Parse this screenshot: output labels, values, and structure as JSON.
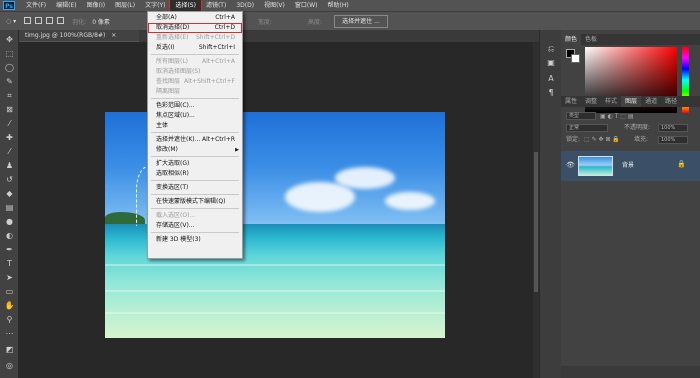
{
  "app": {
    "logo": "Ps"
  },
  "menubar": {
    "items": [
      {
        "label": "文件(F)"
      },
      {
        "label": "编辑(E)"
      },
      {
        "label": "图像(I)"
      },
      {
        "label": "图层(L)"
      },
      {
        "label": "文字(Y)"
      },
      {
        "label": "选择(S)"
      },
      {
        "label": "滤镜(T)"
      },
      {
        "label": "3D(D)"
      },
      {
        "label": "视图(V)"
      },
      {
        "label": "窗口(W)"
      },
      {
        "label": "帮助(H)"
      }
    ],
    "active_index": 5
  },
  "options_bar": {
    "feather_label": "羽化:",
    "feather_value": "0 像素",
    "width_label": "宽度:",
    "height_label": "高度:",
    "select_mask_button": "选择并遮住 ..."
  },
  "document": {
    "tab_label": "timg.jpg @ 100%(RGB/8#)",
    "close_glyph": "×"
  },
  "select_menu": {
    "items": [
      {
        "label": "全部(A)",
        "shortcut": "Ctrl+A",
        "disabled": false
      },
      {
        "label": "取消选择(D)",
        "shortcut": "Ctrl+D",
        "disabled": false,
        "highlighted": true
      },
      {
        "label": "重新选择(E)",
        "shortcut": "Shift+Ctrl+D",
        "disabled": true
      },
      {
        "label": "反选(I)",
        "shortcut": "Shift+Ctrl+I",
        "disabled": false
      },
      {
        "label": "所有图层(L)",
        "shortcut": "Alt+Ctrl+A",
        "disabled": true
      },
      {
        "label": "取消选择图层(S)",
        "shortcut": "",
        "disabled": true
      },
      {
        "label": "查找图层",
        "shortcut": "Alt+Shift+Ctrl+F",
        "disabled": true
      },
      {
        "label": "隔离图层",
        "shortcut": "",
        "disabled": true
      },
      {
        "label": "色彩范围(C)...",
        "shortcut": "",
        "disabled": false
      },
      {
        "label": "焦点区域(U)...",
        "shortcut": "",
        "disabled": false
      },
      {
        "label": "主体",
        "shortcut": "",
        "disabled": false
      },
      {
        "label": "选择并遮住(K)...",
        "shortcut": "Alt+Ctrl+R",
        "disabled": false
      },
      {
        "label": "修改(M)",
        "shortcut": "",
        "disabled": false,
        "submenu": true
      },
      {
        "label": "扩大选取(G)",
        "shortcut": "",
        "disabled": false
      },
      {
        "label": "选取相似(R)",
        "shortcut": "",
        "disabled": false
      },
      {
        "label": "变换选区(T)",
        "shortcut": "",
        "disabled": false
      },
      {
        "label": "在快速蒙版模式下编辑(Q)",
        "shortcut": "",
        "disabled": false
      },
      {
        "label": "载入选区(O)...",
        "shortcut": "",
        "disabled": true
      },
      {
        "label": "存储选区(V)...",
        "shortcut": "",
        "disabled": false
      },
      {
        "label": "新建 3D 模型(3)",
        "shortcut": "",
        "disabled": false
      }
    ]
  },
  "color_panel": {
    "tabs": [
      "颜色",
      "色板"
    ],
    "fg_color": "#000000",
    "bg_color": "#ffffff"
  },
  "layers_panel": {
    "tabs": [
      "属性",
      "调整",
      "样式",
      "图层",
      "通道",
      "路径"
    ],
    "filter_label": "类型",
    "blend_mode": "正常",
    "opacity_label": "不透明度:",
    "opacity_value": "100%",
    "lock_label": "锁定:",
    "fill_label": "填充:",
    "fill_value": "100%",
    "layer_name": "背景"
  },
  "colors": {
    "accent_red": "#d32f2f",
    "layer_selected": "#3b4f66"
  }
}
